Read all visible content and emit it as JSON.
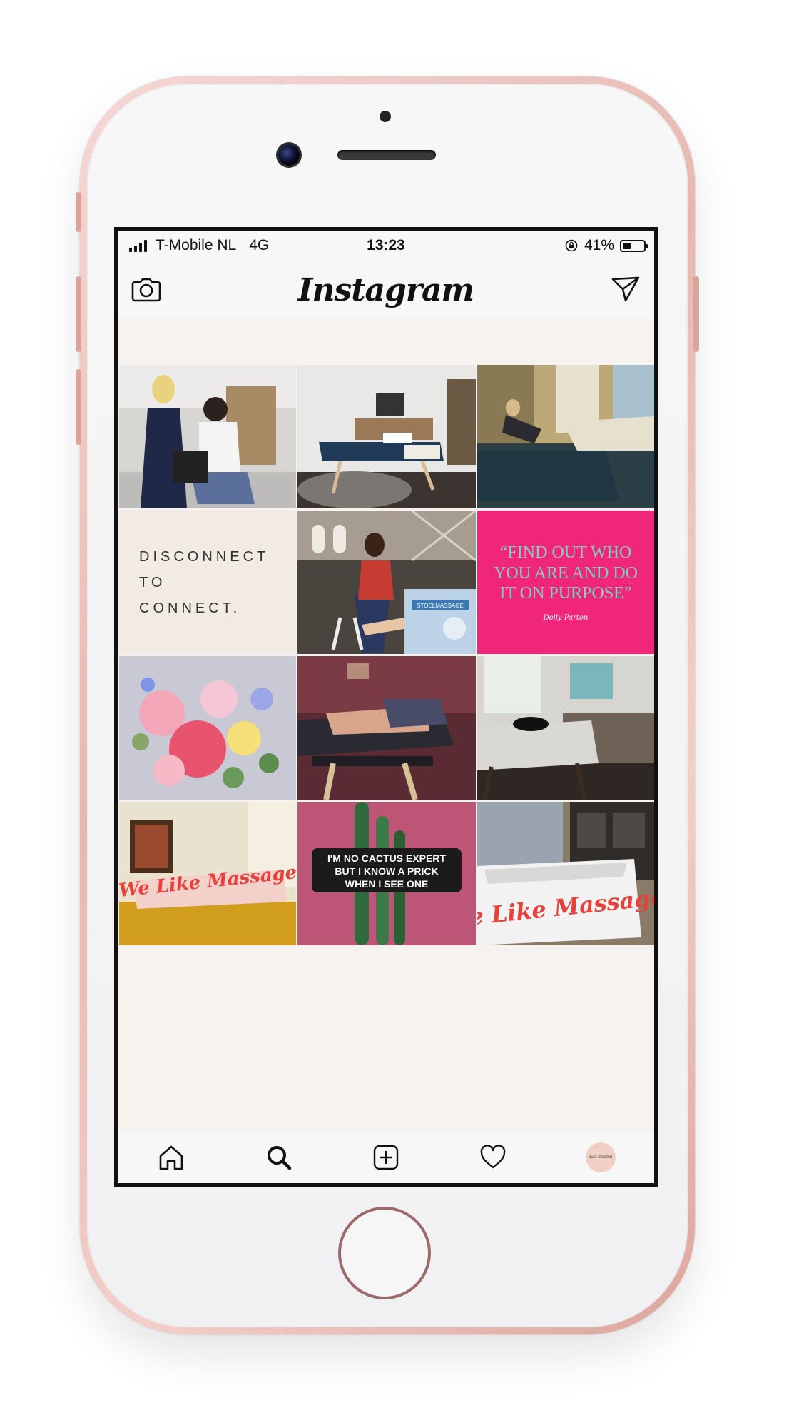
{
  "status_bar": {
    "carrier": "T-Mobile NL",
    "network": "4G",
    "time": "13:23",
    "battery_percent": "41%",
    "battery_level": 0.41
  },
  "header": {
    "title": "Instagram",
    "left_icon": "camera-icon",
    "right_icon": "send-icon"
  },
  "tiles": {
    "disconnect": {
      "line1": "DISCONNECT",
      "line2": "TO",
      "line3": "CONNECT."
    },
    "quote": {
      "text": "“FIND OUT WHO YOU ARE AND DO IT ON PURPOSE”",
      "author": "Dolly Parton"
    },
    "stool_sign": "STOELMASSAGE",
    "cactus_sign": {
      "line1": "I'M NO CACTUS EXPERT",
      "line2": "BUT I KNOW A PRICK",
      "line3": "WHEN I SEE ONE"
    },
    "brand_sign": "We Like Massage"
  },
  "nav": {
    "items": [
      "home-icon",
      "search-icon",
      "new-post-icon",
      "heart-icon",
      "profile-avatar"
    ],
    "active": "search-icon",
    "avatar_text": "Just Shiatsu"
  },
  "colors": {
    "phone_frame": "#e7b8b1",
    "quote_bg": "#f0267a",
    "quote_text": "#7fd2c1",
    "sign_red": "#e8413c"
  }
}
